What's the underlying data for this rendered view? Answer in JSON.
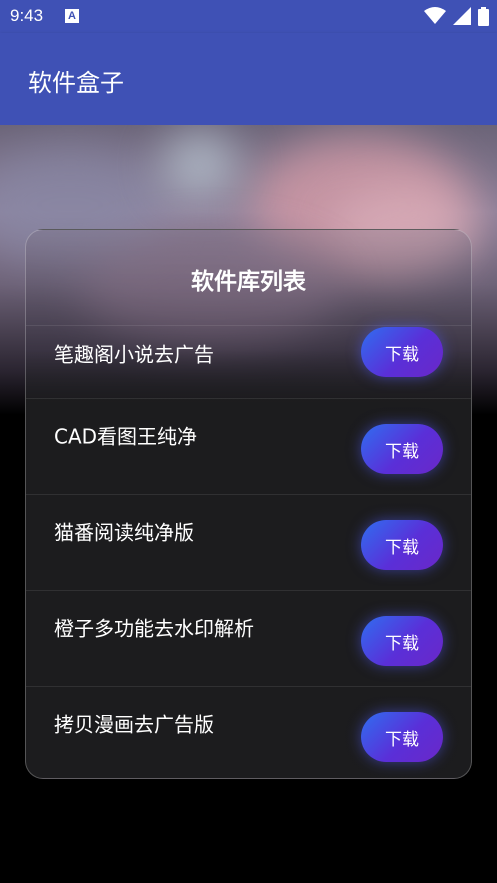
{
  "status_bar": {
    "time": "9:43",
    "notification_icon": "A"
  },
  "app_bar": {
    "title": "软件盒子"
  },
  "card": {
    "title": "软件库列表",
    "items": [
      {
        "label": "笔趣阁小说去广告",
        "button": "下载"
      },
      {
        "label": "CAD看图王纯净",
        "button": "下载"
      },
      {
        "label": "猫番阅读纯净版",
        "button": "下载"
      },
      {
        "label": "橙子多功能去水印解析",
        "button": "下载"
      },
      {
        "label": "拷贝漫画去广告版",
        "button": "下载"
      }
    ]
  },
  "colors": {
    "primary": "#3f51b5",
    "button_start": "#2f6ef0",
    "button_end": "#6a28c8"
  }
}
